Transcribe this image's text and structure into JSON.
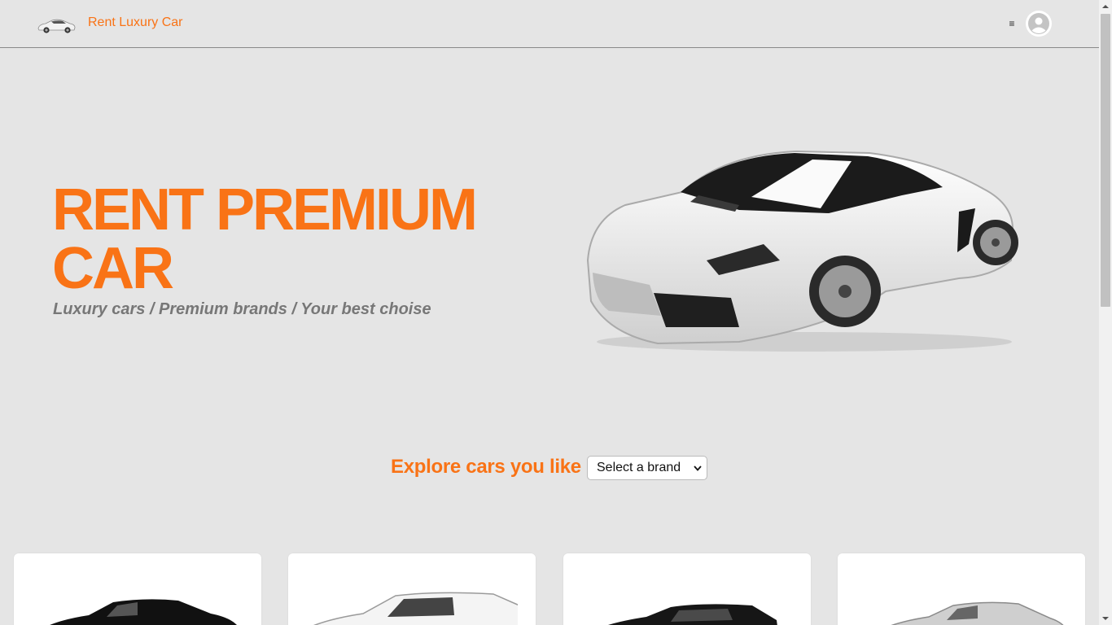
{
  "navbar": {
    "brand_label": "Rent Luxury Car",
    "menu_icon": "≡"
  },
  "hero": {
    "title": "RENT PREMIUM CAR",
    "subtitle": "Luxury cars / Premium brands / Your best choise"
  },
  "explore": {
    "label": "Explore cars you like",
    "brand_select_value": "Select a brand"
  },
  "colors": {
    "accent": "#f97316",
    "background": "#e5e5e5"
  },
  "cards": [
    {
      "car_color": "#111111"
    },
    {
      "car_color": "#f4f4f4"
    },
    {
      "car_color": "#161616"
    },
    {
      "car_color": "#cfcfcf"
    }
  ]
}
